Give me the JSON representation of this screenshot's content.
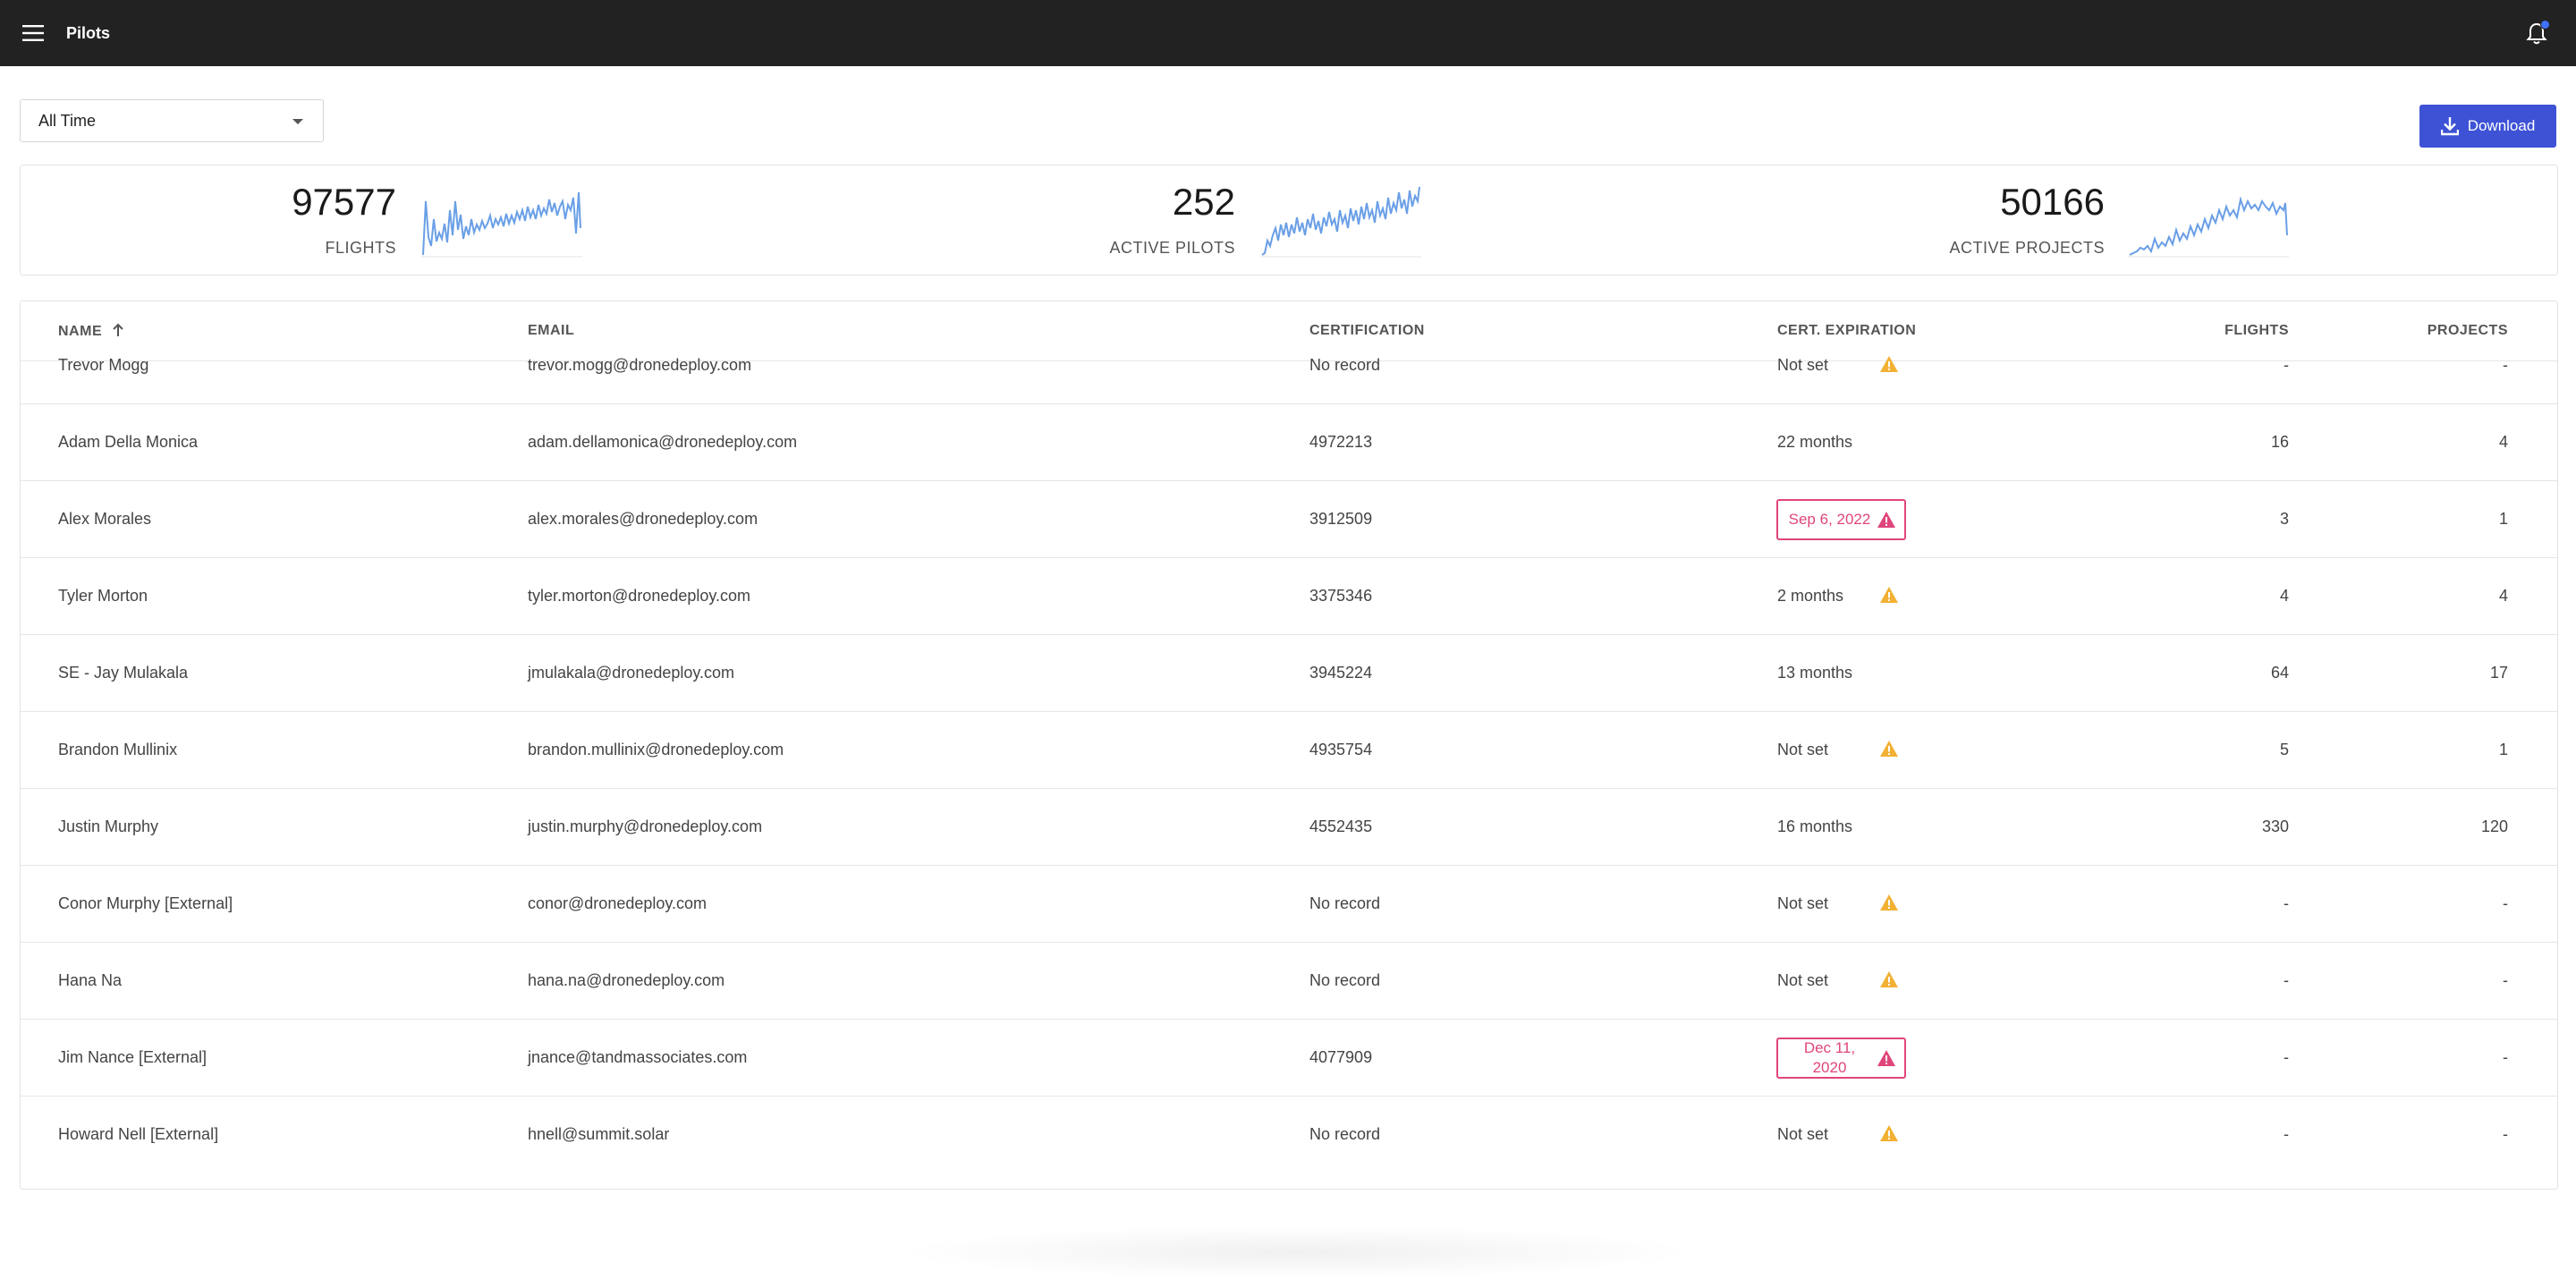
{
  "app": {
    "title": "Pilots"
  },
  "filters": {
    "time_range": "All Time"
  },
  "toolbar": {
    "download_label": "Download"
  },
  "stats": [
    {
      "value": "97577",
      "label": "FLIGHTS"
    },
    {
      "value": "252",
      "label": "ACTIVE PILOTS"
    },
    {
      "value": "50166",
      "label": "ACTIVE PROJECTS"
    }
  ],
  "table": {
    "columns": {
      "name": "NAME",
      "email": "EMAIL",
      "certification": "CERTIFICATION",
      "cert_expiration": "CERT. EXPIRATION",
      "flights": "FLIGHTS",
      "projects": "PROJECTS"
    },
    "sort": {
      "column": "name",
      "direction": "ascending"
    },
    "rows": [
      {
        "name": "Trevor Mogg",
        "email": "trevor.mogg@dronedeploy.com",
        "certification": "No record",
        "expiration": "Not set",
        "status": "warning",
        "flights": "-",
        "projects": "-"
      },
      {
        "name": "Adam Della Monica",
        "email": "adam.dellamonica@dronedeploy.com",
        "certification": "4972213",
        "expiration": "22 months",
        "status": "ok",
        "flights": "16",
        "projects": "4"
      },
      {
        "name": "Alex Morales",
        "email": "alex.morales@dronedeploy.com",
        "certification": "3912509",
        "expiration": "Sep 6, 2022",
        "status": "expired",
        "flights": "3",
        "projects": "1"
      },
      {
        "name": "Tyler Morton",
        "email": "tyler.morton@dronedeploy.com",
        "certification": "3375346",
        "expiration": "2 months",
        "status": "warning",
        "flights": "4",
        "projects": "4"
      },
      {
        "name": "SE - Jay Mulakala",
        "email": "jmulakala@dronedeploy.com",
        "certification": "3945224",
        "expiration": "13 months",
        "status": "ok",
        "flights": "64",
        "projects": "17"
      },
      {
        "name": "Brandon Mullinix",
        "email": "brandon.mullinix@dronedeploy.com",
        "certification": "4935754",
        "expiration": "Not set",
        "status": "warning",
        "flights": "5",
        "projects": "1"
      },
      {
        "name": "Justin Murphy",
        "email": "justin.murphy@dronedeploy.com",
        "certification": "4552435",
        "expiration": "16 months",
        "status": "ok",
        "flights": "330",
        "projects": "120"
      },
      {
        "name": "Conor Murphy [External]",
        "email": "conor@dronedeploy.com",
        "certification": "No record",
        "expiration": "Not set",
        "status": "warning",
        "flights": "-",
        "projects": "-"
      },
      {
        "name": "Hana Na",
        "email": "hana.na@dronedeploy.com",
        "certification": "No record",
        "expiration": "Not set",
        "status": "warning",
        "flights": "-",
        "projects": "-"
      },
      {
        "name": "Jim Nance [External]",
        "email": "jnance@tandmassociates.com",
        "certification": "4077909",
        "expiration": "Dec 11, 2020",
        "status": "expired",
        "flights": "-",
        "projects": "-"
      },
      {
        "name": "Howard Nell [External]",
        "email": "hnell@summit.solar",
        "certification": "No record",
        "expiration": "Not set",
        "status": "warning",
        "flights": "-",
        "projects": "-"
      }
    ]
  },
  "icons": {
    "menu": "menu-icon",
    "notifications": "bell-icon",
    "dropdown": "caret-down-icon",
    "download": "download-icon",
    "sort": "arrow-up-icon",
    "warning": "warning-triangle-icon"
  },
  "colors": {
    "appbar": "#222222",
    "accent": "#3d52d5",
    "sparkline": "#6a9fe6",
    "warning": "#f2b134",
    "expired": "#e0457b"
  }
}
